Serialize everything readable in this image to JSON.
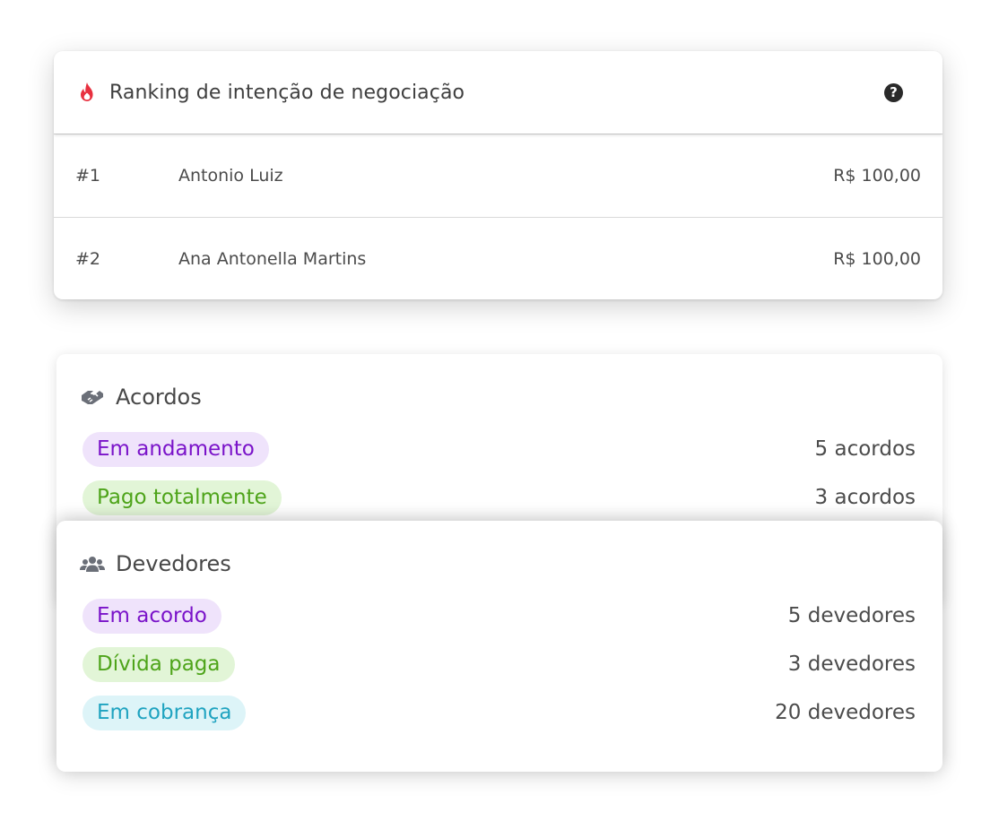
{
  "ranking": {
    "title": "Ranking de intenção de negociação",
    "title_icon": "fire-icon",
    "help_icon": "question-circle-icon",
    "rows": [
      {
        "position": "#1",
        "name": "Antonio Luiz",
        "amount": "R$ 100,00"
      },
      {
        "position": "#2",
        "name": "Ana Antonella Martins",
        "amount": "R$ 100,00"
      }
    ]
  },
  "acordos": {
    "title": "Acordos",
    "icon": "handshake-icon",
    "items": [
      {
        "label": "Em andamento",
        "value": "5 acordos",
        "color": "purple"
      },
      {
        "label": "Pago totalmente",
        "value": "3 acordos",
        "color": "green"
      }
    ]
  },
  "devedores": {
    "title": "Devedores",
    "icon": "users-icon",
    "items": [
      {
        "label": "Em acordo",
        "value": "5 devedores",
        "color": "purple"
      },
      {
        "label": "Dívida paga",
        "value": "3 devedores",
        "color": "green"
      },
      {
        "label": "Em cobrança",
        "value": "20 devedores",
        "color": "cyan"
      }
    ]
  },
  "colors": {
    "accent_red": "#e8303f",
    "purple_text": "#7a13c9",
    "purple_bg": "#efe3fb",
    "green_text": "#4ea41a",
    "green_bg": "#e2f5d7",
    "cyan_text": "#1fa3c0",
    "cyan_bg": "#ddf4f8"
  }
}
